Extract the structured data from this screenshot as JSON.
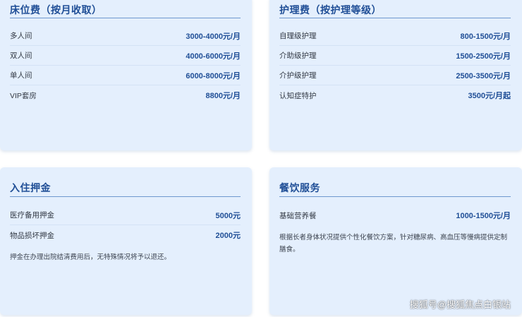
{
  "bed_fee": {
    "title": "床位费（按月收取）",
    "rows": [
      {
        "label": "多人间",
        "price": "3000-4000元/月"
      },
      {
        "label": "双人间",
        "price": "4000-6000元/月"
      },
      {
        "label": "单人间",
        "price": "6000-8000元/月"
      },
      {
        "label": "VIP套房",
        "price": "8800元/月"
      }
    ]
  },
  "nursing_fee": {
    "title": "护理费（按护理等级）",
    "rows": [
      {
        "label": "自理级护理",
        "price": "800-1500元/月"
      },
      {
        "label": "介助级护理",
        "price": "1500-2500元/月"
      },
      {
        "label": "介护级护理",
        "price": "2500-3500元/月"
      },
      {
        "label": "认知症特护",
        "price": "3500元/月起"
      }
    ]
  },
  "deposit": {
    "title": "入住押金",
    "rows": [
      {
        "label": "医疗备用押金",
        "price": "5000元"
      },
      {
        "label": "物品损坏押金",
        "price": "2000元"
      }
    ],
    "note": "押金在办理出院结清费用后，无特殊情况将予以退还。"
  },
  "dining": {
    "title": "餐饮服务",
    "rows": [
      {
        "label": "基础营养餐",
        "price": "1000-1500元/月"
      }
    ],
    "note": "根据长者身体状况提供个性化餐饮方案，针对糖尿病、高血压等慢病提供定制膳食。"
  },
  "watermark": "搜狐号@搜狐焦点白银站",
  "colors": {
    "card_bg": "#e4effd",
    "title": "#1f4e96",
    "price": "#1f4e96",
    "rule": "#6f98cf"
  }
}
